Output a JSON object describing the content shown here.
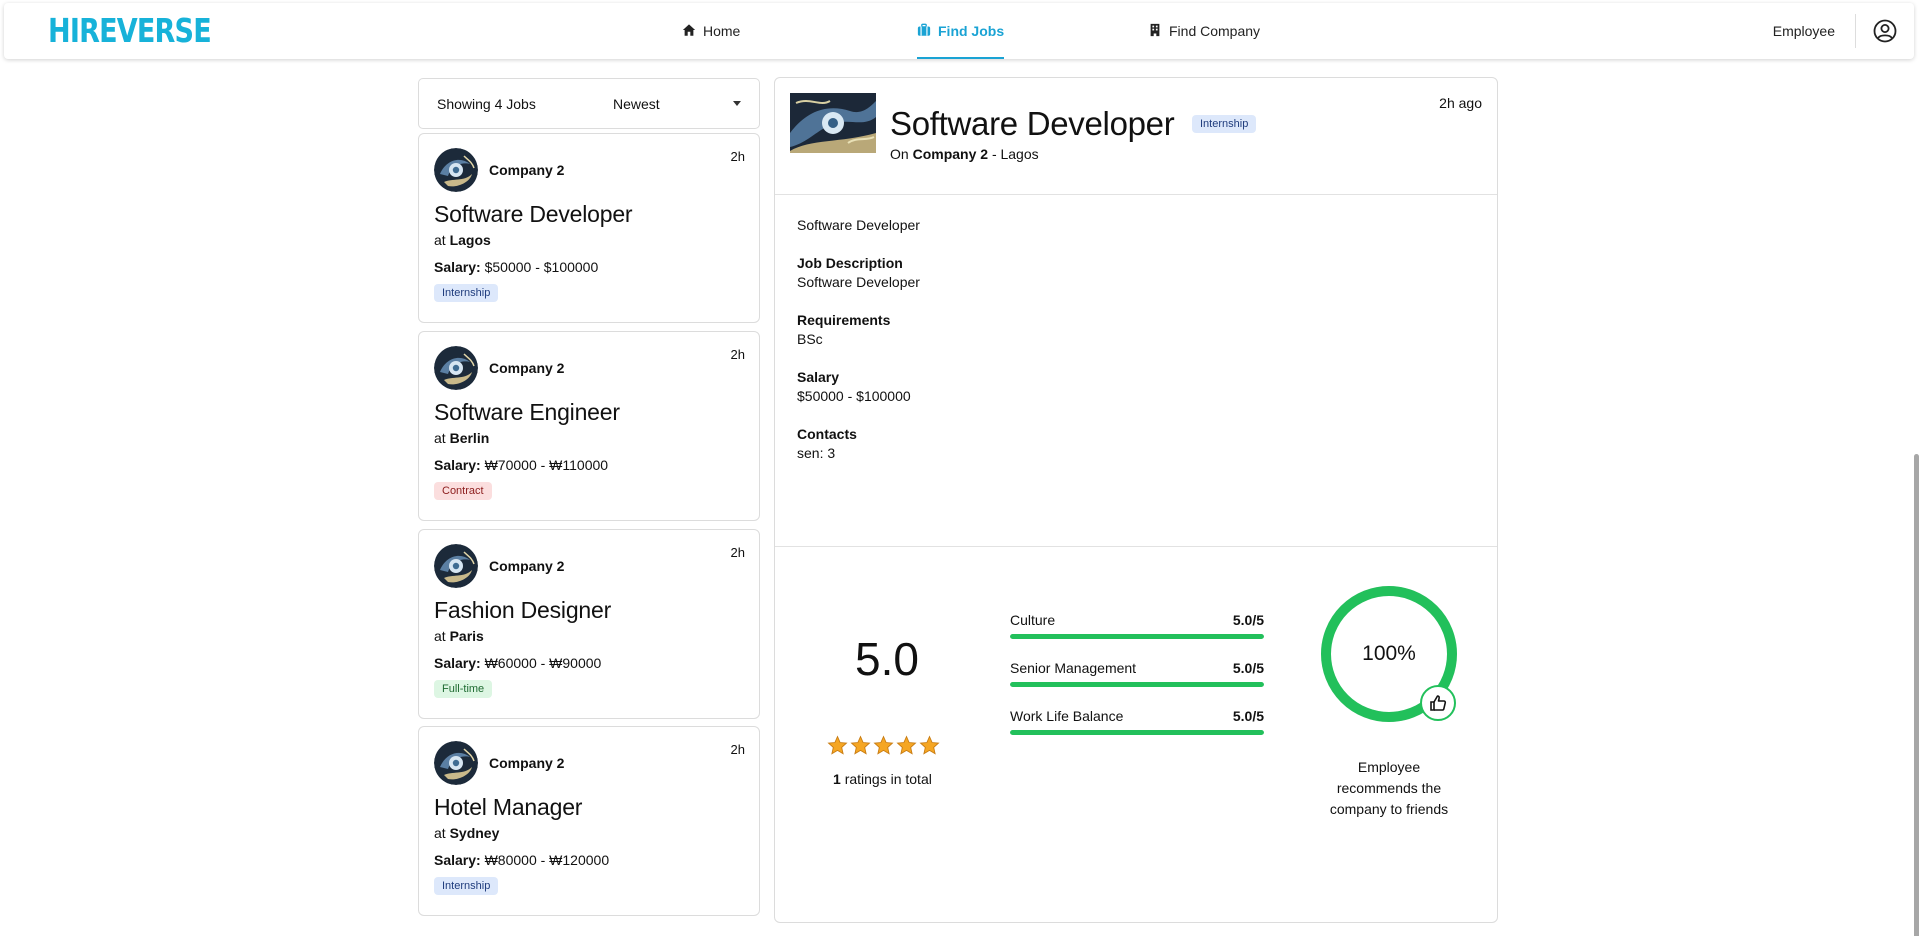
{
  "app": {
    "logo": "HIREVERSE",
    "brand_color": "#17b2d9",
    "accent_color": "#1aa3d4"
  },
  "nav": {
    "home": "Home",
    "find_jobs": "Find Jobs",
    "find_company": "Find Company",
    "employee": "Employee",
    "active": "find_jobs"
  },
  "list": {
    "count_label": "Showing 4 Jobs",
    "sort_selected": "Newest",
    "jobs": [
      {
        "company": "Company 2",
        "time": "2h",
        "title": "Software Developer",
        "at": "at",
        "location": "Lagos",
        "salary_label": "Salary:",
        "salary": "$50000 - $100000",
        "type": "Internship",
        "type_style": "intern"
      },
      {
        "company": "Company 2",
        "time": "2h",
        "title": "Software Engineer",
        "at": "at",
        "location": "Berlin",
        "salary_label": "Salary:",
        "salary": "₩70000 - ₩110000",
        "type": "Contract",
        "type_style": "contract"
      },
      {
        "company": "Company 2",
        "time": "2h",
        "title": "Fashion Designer",
        "at": "at",
        "location": "Paris",
        "salary_label": "Salary:",
        "salary": "₩60000 - ₩90000",
        "type": "Full-time",
        "type_style": "fulltime"
      },
      {
        "company": "Company 2",
        "time": "2h",
        "title": "Hotel Manager",
        "at": "at",
        "location": "Sydney",
        "salary_label": "Salary:",
        "salary": "₩80000 - ₩120000",
        "type": "Internship",
        "type_style": "intern"
      }
    ]
  },
  "detail": {
    "title": "Software Developer",
    "type": "Internship",
    "on": "On",
    "company": "Company 2",
    "location_sep": "- Lagos",
    "time": "2h ago",
    "summary": "Software Developer",
    "job_description_label": "Job Description",
    "job_description": "Software Developer",
    "requirements_label": "Requirements",
    "requirements": "BSc",
    "salary_label": "Salary",
    "salary": "$50000 - $100000",
    "contacts_label": "Contacts",
    "contacts": "sen: 3"
  },
  "rating": {
    "score": "5.0",
    "stars": 5,
    "total_count": "1",
    "total_suffix": "ratings in total",
    "categories": [
      {
        "name": "Culture",
        "value": "5.0/5",
        "fraction": 1.0
      },
      {
        "name": "Senior Management",
        "value": "5.0/5",
        "fraction": 1.0
      },
      {
        "name": "Work Life Balance",
        "value": "5.0/5",
        "fraction": 1.0
      }
    ],
    "recommend_percent": "100%",
    "recommend_fraction": 1.0,
    "recommend_text": "Employee recommends the company to friends",
    "green": "#22c05b",
    "star_color": "#f5a623"
  }
}
